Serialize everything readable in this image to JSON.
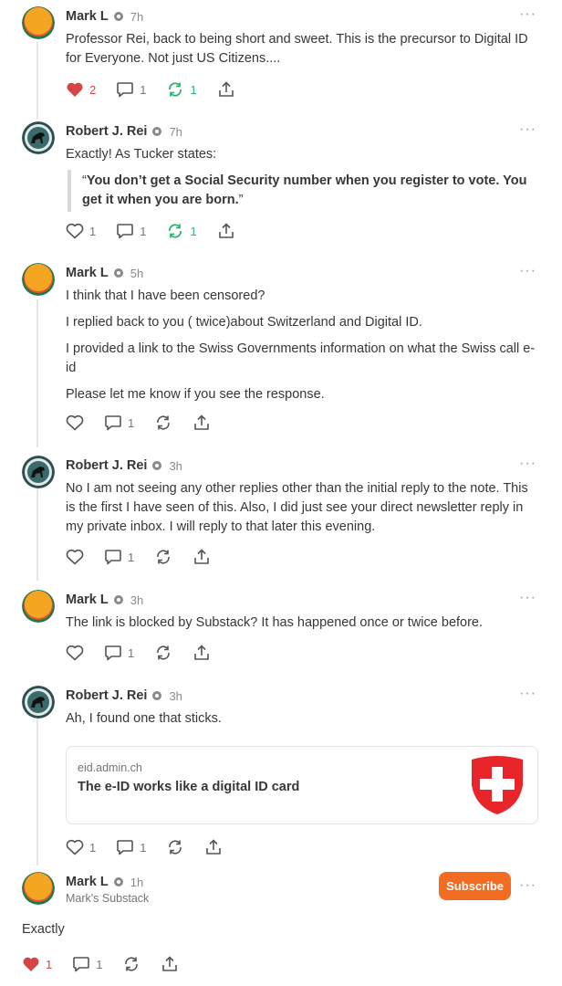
{
  "comments": [
    {
      "author": "Mark L",
      "time": "7h",
      "paragraphs": [
        "Professor Rei, back to being short and sweet. This is the precursor to Digital ID for Everyone. Not just US Citizens...."
      ],
      "likes": "2",
      "replies": "1",
      "restacks": "1",
      "liked": true,
      "restacked": true
    },
    {
      "author": "Robert J. Rei",
      "time": "7h",
      "paragraphs": [
        "Exactly! As Tucker states:"
      ],
      "quote": "You don’t get a Social Security number when you register to vote. You get it when you are born.",
      "quote_open": "“",
      "quote_close": "”",
      "likes": "1",
      "replies": "1",
      "restacks": "1",
      "liked": false,
      "restacked": true
    },
    {
      "author": "Mark L",
      "time": "5h",
      "paragraphs": [
        "I think that I have been censored?",
        "I replied back to you ( twice)about Switzerland and Digital ID.",
        "I provided a link to the Swiss Governments information on what the Swiss call e-id",
        "Please let me know if you see the response."
      ],
      "likes": "",
      "replies": "1",
      "restacks": ""
    },
    {
      "author": "Robert J. Rei",
      "time": "3h",
      "paragraphs": [
        "No I am not seeing any other replies other than the initial reply to the note. This is the first I have seen of this. Also, I did just see your direct newsletter reply in my private inbox. I will reply to that later this evening."
      ],
      "likes": "",
      "replies": "1",
      "restacks": ""
    },
    {
      "author": "Mark L",
      "time": "3h",
      "paragraphs": [
        "The link is blocked by Substack? It has happened once or twice before."
      ],
      "likes": "",
      "replies": "1",
      "restacks": ""
    },
    {
      "author": "Robert J. Rei",
      "time": "3h",
      "paragraphs": [
        "Ah, I found one that sticks."
      ],
      "link": {
        "domain": "eid.admin.ch",
        "title": "The e-ID works like a digital ID card"
      },
      "likes": "1",
      "replies": "1",
      "restacks": ""
    },
    {
      "author": "Mark L",
      "time": "1h",
      "subtitle": "Mark's Substack",
      "subscribe_label": "Subscribe",
      "paragraphs": [
        "Exactly"
      ],
      "likes": "1",
      "replies": "1",
      "restacks": "",
      "liked": true
    }
  ],
  "more_icon": "···",
  "colors": {
    "accent": "#f26c21",
    "like": "#d64545",
    "restack": "#2db473"
  }
}
